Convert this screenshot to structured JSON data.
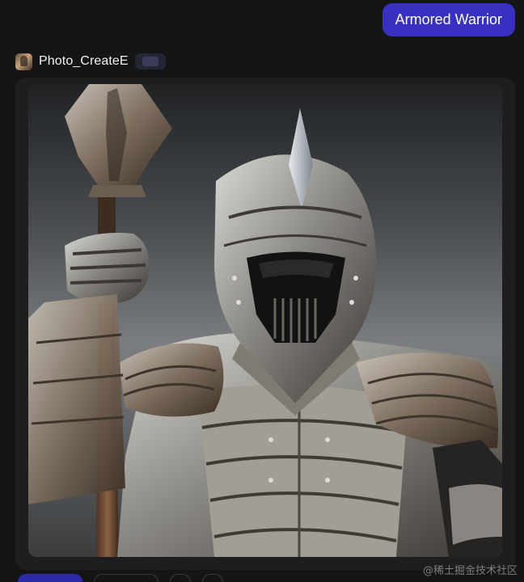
{
  "chat": {
    "user_message": "Armored Warrior",
    "bot": {
      "name": "Photo_CreateE",
      "avatar_icon": "bot-avatar-icon",
      "badge_icon": "bot-badge-icon"
    },
    "response": {
      "image_subject": "armored-knight-with-spear-image"
    }
  },
  "watermark": "@稀土掘金技术社区",
  "colors": {
    "background": "#151516",
    "user_bubble": "#3730c2",
    "card": "#1e1e20"
  }
}
